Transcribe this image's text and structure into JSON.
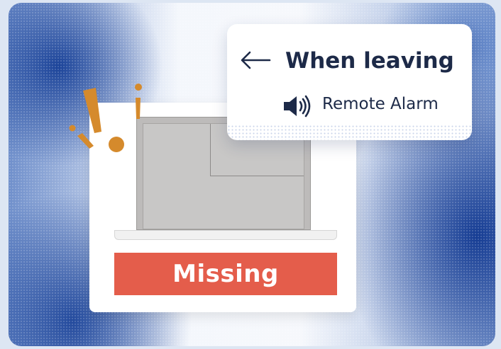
{
  "status_banner": {
    "label": "Missing",
    "color": "#e45d4b"
  },
  "popup": {
    "title": "When leaving",
    "action_label": "Remote Alarm",
    "back_icon": "arrow-left-icon",
    "action_icon": "speaker-volume-icon"
  },
  "device": {
    "type": "laptop",
    "alert_icon": "exclamation-alert-icon",
    "alert_color": "#d58a2c"
  }
}
